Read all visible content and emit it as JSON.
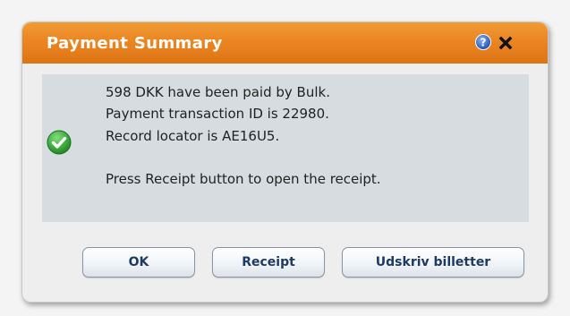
{
  "dialog": {
    "title": "Payment Summary",
    "help_icon": "help-circle-icon",
    "close_icon": "close-icon",
    "status_icon": "success-check-icon",
    "message_lines": [
      "598 DKK have been paid by Bulk.",
      "Payment transaction ID is 22980.",
      "Record locator is AE16U5.",
      "Press Receipt button to open the receipt."
    ],
    "buttons": {
      "ok": "OK",
      "receipt": "Receipt",
      "print_tickets": "Udskriv billetter"
    }
  },
  "colors": {
    "titlebar": "#ea8420",
    "message_panel": "#d6dce0",
    "button_text": "#1c3a63",
    "check_green": "#2fa22f"
  }
}
